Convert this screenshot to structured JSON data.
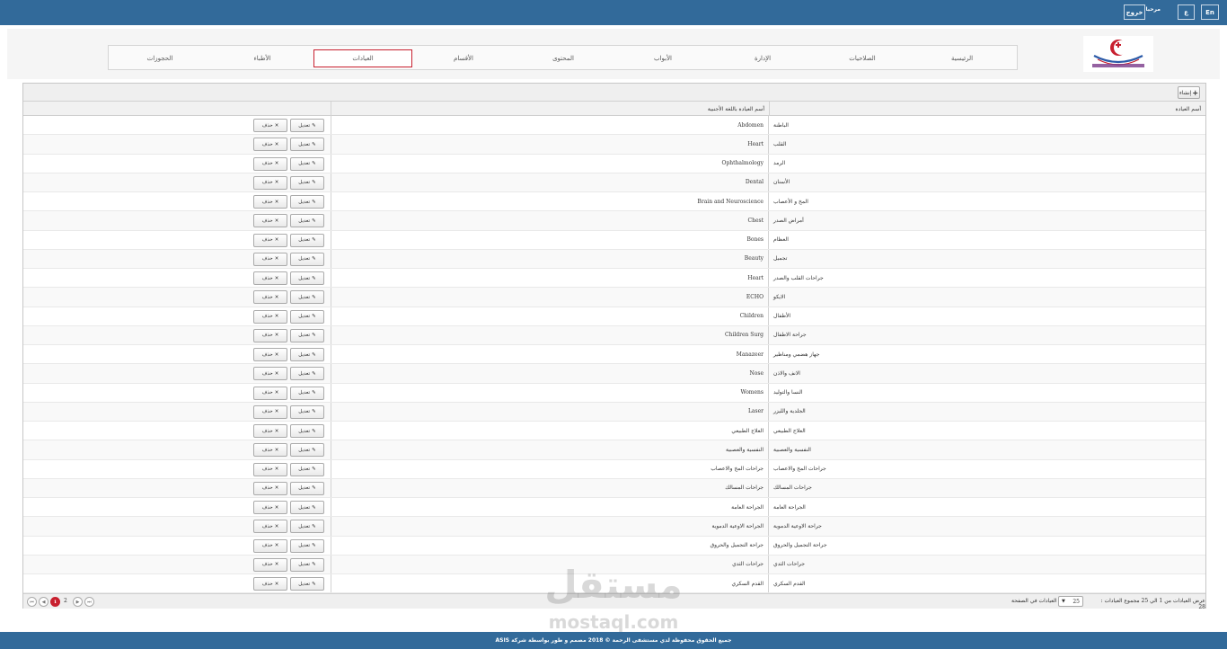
{
  "topbar": {
    "lang_en": "En",
    "lang_ar": "ع",
    "welcome": "مرحبا",
    "user_button": "خروج"
  },
  "nav": {
    "items": [
      {
        "label": "الرئيسية"
      },
      {
        "label": "الصلاحيات"
      },
      {
        "label": "الإدارة"
      },
      {
        "label": "الأبواب"
      },
      {
        "label": "المحتوى"
      },
      {
        "label": "الأقسام"
      },
      {
        "label": "العيادات",
        "active": true
      },
      {
        "label": "الأطباء"
      },
      {
        "label": "الحجوزات"
      }
    ]
  },
  "toolbar": {
    "create_label": "إنشاء",
    "create_icon": "plus-icon"
  },
  "table": {
    "headers": {
      "name_ar": "أسم العيادة",
      "name_en": "أسم العيادة باللغة الأجنبية",
      "actions": ""
    },
    "edit_label": "تعديل",
    "delete_label": "حذف",
    "rows": [
      {
        "ar": "الباطنة",
        "en": "Abdomen"
      },
      {
        "ar": "القلب",
        "en": "Heart"
      },
      {
        "ar": "الرمد",
        "en": "Ophthalmology"
      },
      {
        "ar": "الأسنان",
        "en": "Dental"
      },
      {
        "ar": "المخ و الأعصاب",
        "en": "Brain and Neuroscience"
      },
      {
        "ar": "أمراض الصدر",
        "en": "Chest"
      },
      {
        "ar": "العظام",
        "en": "Bones"
      },
      {
        "ar": "تجميل",
        "en": "Beauty"
      },
      {
        "ar": "جراحات القلب والصدر",
        "en": "Heart"
      },
      {
        "ar": "الايكو",
        "en": "ECHO"
      },
      {
        "ar": "الأطفال",
        "en": "Children"
      },
      {
        "ar": "جراحة الاطفال",
        "en": "Children Surg"
      },
      {
        "ar": "جهاز هضمي ومناظير",
        "en": "Manazeer"
      },
      {
        "ar": "الانف والاذن",
        "en": "Nose"
      },
      {
        "ar": "النسا والتوليد",
        "en": "Womens"
      },
      {
        "ar": "الجلدية والليزر",
        "en": "Laser"
      },
      {
        "ar": "العلاج الطبيعي",
        "en": "العلاج الطبيعي"
      },
      {
        "ar": "النفسية والعصبية",
        "en": "النفسية والعصبية"
      },
      {
        "ar": "جراحات المخ والاعصاب",
        "en": "جراحات المخ والاعصاب"
      },
      {
        "ar": "جراحات المسالك",
        "en": "جراحات المسالك"
      },
      {
        "ar": "الجراحة العامة",
        "en": "الجراحة العامة"
      },
      {
        "ar": "جراحة الاوعية الدموية",
        "en": "الجراحة الاوعية الدموية"
      },
      {
        "ar": "جراحة التجميل والحروق",
        "en": "جراحة التجميل والحروق"
      },
      {
        "ar": "جراحات الثدي",
        "en": "جراحات الثدي"
      },
      {
        "ar": "القدم السكري",
        "en": "القدم السكري"
      }
    ]
  },
  "pager": {
    "first": "⏮",
    "prev": "◀",
    "current_page": "1",
    "next_page": "2",
    "next": "▶",
    "last": "⏭",
    "per_page_value": "25",
    "per_page_label": "العيادات في الصفحة",
    "summary": "عرض العيادات من 1 الي 25 مجموع العيادات : 28"
  },
  "watermark": {
    "ar": "مستقل",
    "en": "mostaql.com"
  },
  "footer": {
    "text": "جميع الحقوق محفوظة لدي مستشفى الرحمة © 2018 مصمم و طور بواسطة شركة ASIS"
  },
  "colors": {
    "topbar": "#326a9a",
    "active_border": "#c8202f",
    "footer": "#326a9a"
  }
}
